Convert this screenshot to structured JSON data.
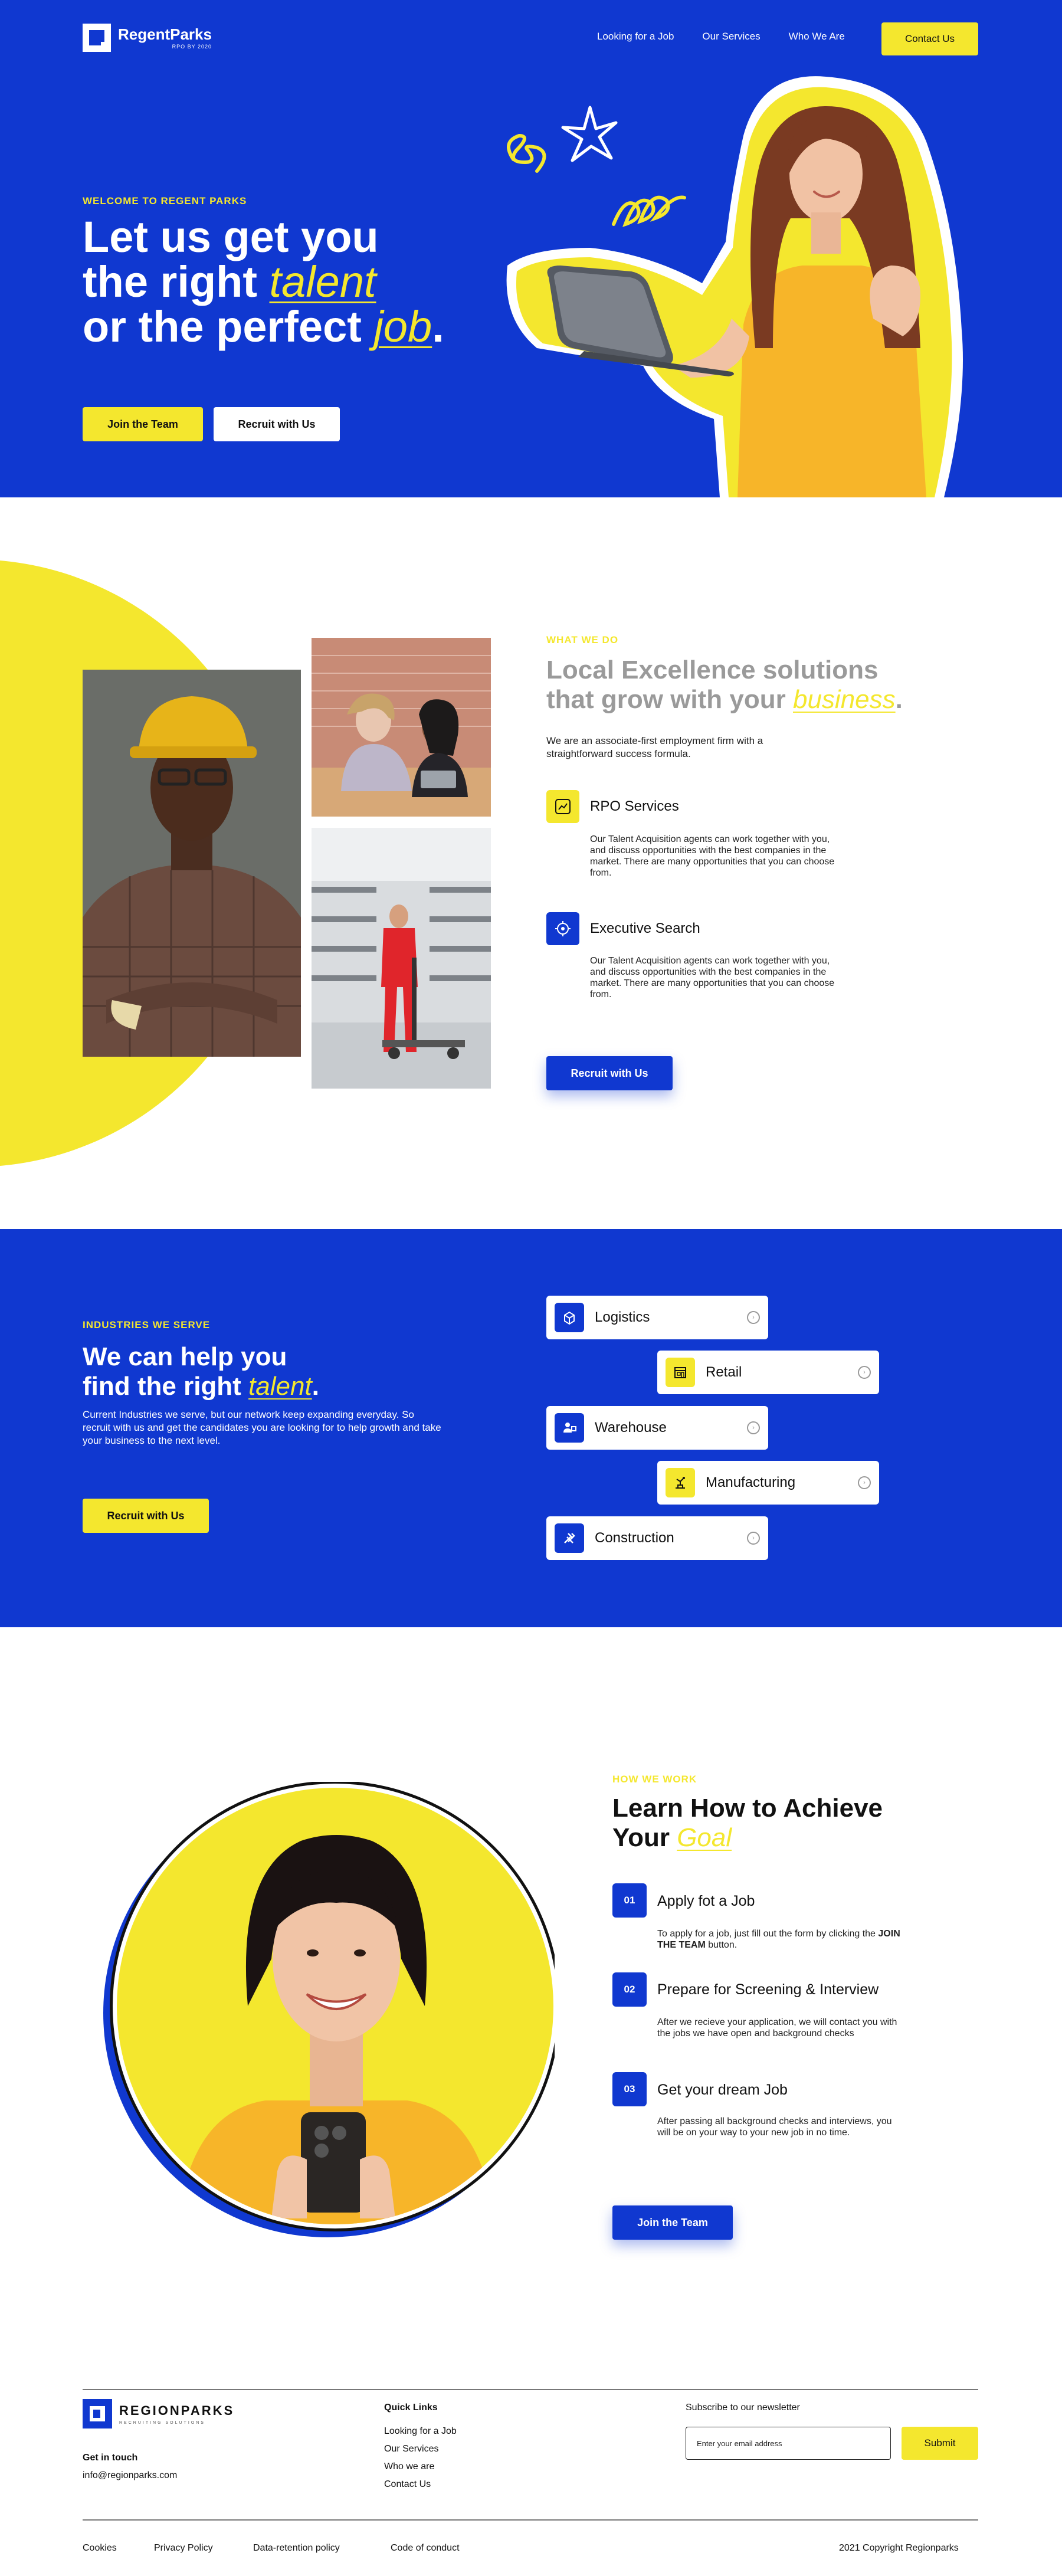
{
  "nav": {
    "logo": "RegentParks",
    "logo_sub": "RPO BY 2020",
    "links": [
      "Looking for a Job",
      "Our Services",
      "Who We Are"
    ],
    "contact_label": "Contact Us"
  },
  "hero": {
    "eyebrow": "WELCOME TO REGENT PARKS",
    "line1": "Let us get you",
    "line2_pre": "the right ",
    "line2_accent": "talent",
    "line3_pre": "or the perfect ",
    "line3_accent": "job",
    "line3_post": ".",
    "btn_join": "Join the Team",
    "btn_recruit": "Recruit with Us"
  },
  "what_we_do": {
    "eyebrow": "WHAT WE DO",
    "title_line1": "Local Excellence solutions",
    "title_line2_pre": "that grow with your ",
    "title_accent": "business",
    "title_post": ".",
    "lead": "We are an associate-first employment firm with a straightforward success formula.",
    "services": [
      {
        "title": "RPO Services",
        "desc": "Our Talent Acquisition agents can work together with you, and discuss opportunities with the best companies in the market. There are many opportunities that you can choose from."
      },
      {
        "title": "Executive Search",
        "desc": "Our Talent Acquisition agents can work together with you, and discuss opportunities with the best companies in the market. There are many opportunities that you can choose from."
      }
    ],
    "btn_recruit": "Recruit with Us"
  },
  "industries": {
    "eyebrow": "INDUSTRIES WE SERVE",
    "title_line1": "We can help you",
    "title_line2_pre": "find the right ",
    "title_accent": "talent",
    "title_post": ".",
    "lead": "Current Industries we serve, but our network keep expanding everyday. So recruit with us and get the candidates you are looking for to help growth and take your business to the next level.",
    "btn_recruit": "Recruit with Us",
    "items": [
      "Logistics",
      "Retail",
      "Warehouse",
      "Manufacturing",
      "Construction"
    ]
  },
  "how_we_work": {
    "eyebrow": "HOW WE WORK",
    "title_line1": "Learn How to Achieve",
    "title_line2_pre": "Your ",
    "title_accent": "Goal",
    "steps": [
      {
        "num": "01",
        "title": "Apply fot a Job",
        "desc_pre": "To apply for a job, just fill out the form by clicking the ",
        "desc_bold": "JOIN THE TEAM",
        "desc_post": " button."
      },
      {
        "num": "02",
        "title": "Prepare for Screening & Interview",
        "desc": "After we recieve your application, we will contact you with the jobs we have open and background checks"
      },
      {
        "num": "03",
        "title": "Get your dream Job",
        "desc": "After passing all background checks and interviews, you will be on your way to your new job in no time."
      }
    ],
    "btn_join": "Join the Team"
  },
  "footer": {
    "logo": "REGIONPARKS",
    "logo_sub": "RECRUITING SOLUTIONS",
    "get_in_touch": "Get in touch",
    "email": "info@regionparks.com",
    "quick_links_head": "Quick Links",
    "quick_links": [
      "Looking for a Job",
      "Our Services",
      "Who we are",
      "Contact Us"
    ],
    "newsletter_head": "Subscribe to our newsletter",
    "email_placeholder": "Enter your email address",
    "submit": "Submit",
    "bottom_links": [
      "Cookies",
      "Privacy Policy",
      "Data-retention policy",
      "Code of conduct"
    ],
    "copyright": "2021 Copyright Regionparks"
  },
  "colors": {
    "brand_blue": "#1038d0",
    "brand_yellow": "#f4e72e"
  }
}
